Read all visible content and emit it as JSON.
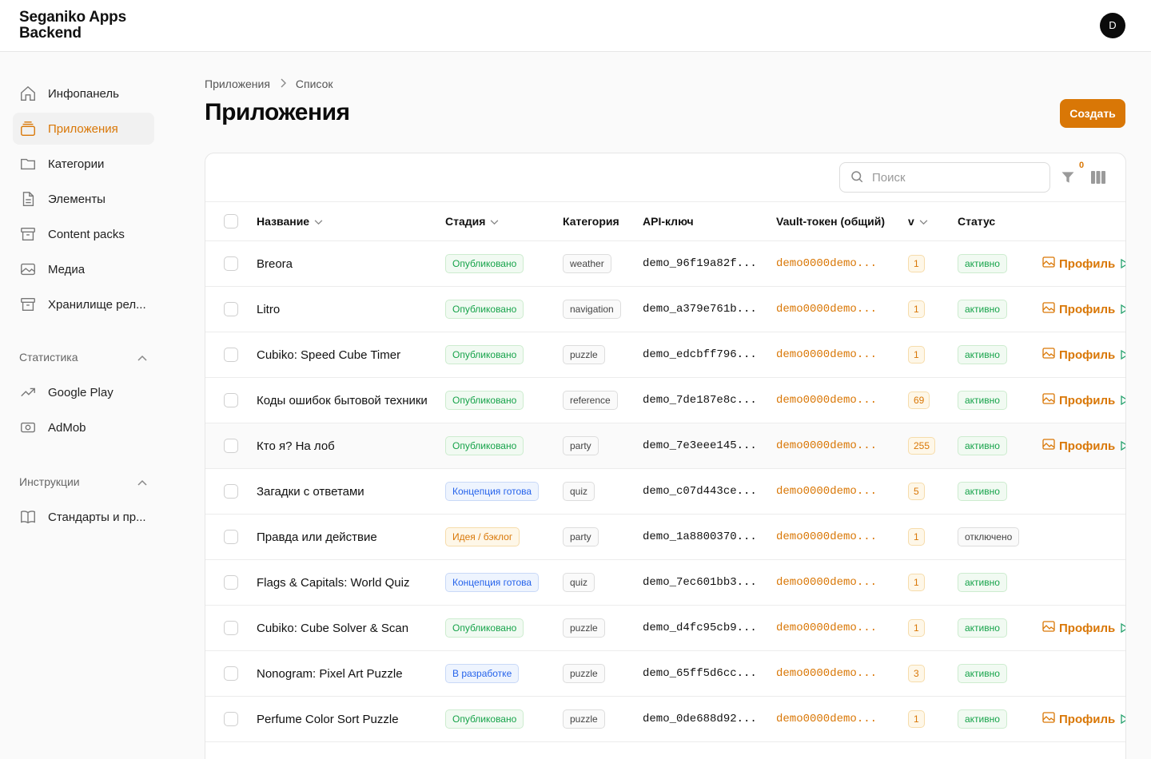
{
  "brand": {
    "line1": "Seganiko Apps",
    "line2": "Backend"
  },
  "user": {
    "avatar_initial": "D"
  },
  "sidebar": {
    "items": [
      {
        "label": "Инфопанель",
        "icon": "home-icon"
      },
      {
        "label": "Приложения",
        "icon": "layers-icon",
        "active": true
      },
      {
        "label": "Категории",
        "icon": "folder-icon"
      },
      {
        "label": "Элементы",
        "icon": "file-icon"
      },
      {
        "label": "Content packs",
        "icon": "archive-icon"
      },
      {
        "label": "Медиа",
        "icon": "image-icon"
      },
      {
        "label": "Хранилище рел...",
        "icon": "archive-icon"
      }
    ],
    "sections": [
      {
        "title": "Статистика",
        "items": [
          {
            "label": "Google Play",
            "icon": "trending-up-icon"
          },
          {
            "label": "AdMob",
            "icon": "money-icon"
          }
        ]
      },
      {
        "title": "Инструкции",
        "items": [
          {
            "label": "Стандарты и пр...",
            "icon": "book-icon"
          }
        ]
      }
    ]
  },
  "breadcrumb": {
    "root": "Приложения",
    "current": "Список"
  },
  "page": {
    "title": "Приложения",
    "create_label": "Создать"
  },
  "toolbar": {
    "search_placeholder": "Поиск",
    "filter_count": "0"
  },
  "colors": {
    "accent": "#d97706",
    "published": "#16a34a",
    "concept": "#2563eb"
  },
  "table": {
    "headers": {
      "name": "Название",
      "stage": "Стадия",
      "category": "Категория",
      "api": "API-ключ",
      "vault": "Vault-токен (общий)",
      "version": "v",
      "status": "Статус"
    },
    "profile_label": "Профиль",
    "rows": [
      {
        "name": "Breora",
        "stage": "Опубликовано",
        "stage_kind": "green",
        "category": "weather",
        "api": "demo_96f19a82f...",
        "vault": "demo0000demo...",
        "version": "1",
        "status": "активно",
        "profile": true
      },
      {
        "name": "Litro",
        "stage": "Опубликовано",
        "stage_kind": "green",
        "category": "navigation",
        "api": "demo_a379e761b...",
        "vault": "demo0000demo...",
        "version": "1",
        "status": "активно",
        "profile": true
      },
      {
        "name": "Cubiko: Speed Cube Timer",
        "stage": "Опубликовано",
        "stage_kind": "green",
        "category": "puzzle",
        "api": "demo_edcbff796...",
        "vault": "demo0000demo...",
        "version": "1",
        "status": "активно",
        "profile": true
      },
      {
        "name": "Коды ошибок бытовой техники",
        "stage": "Опубликовано",
        "stage_kind": "green",
        "category": "reference",
        "api": "demo_7de187e8c...",
        "vault": "demo0000demo...",
        "version": "69",
        "status": "активно",
        "profile": true
      },
      {
        "name": "Кто я? На лоб",
        "stage": "Опубликовано",
        "stage_kind": "green",
        "category": "party",
        "api": "demo_7e3eee145...",
        "vault": "demo0000demo...",
        "version": "255",
        "status": "активно",
        "profile": true,
        "hover": true
      },
      {
        "name": "Загадки с ответами",
        "stage": "Концепция готова",
        "stage_kind": "blue",
        "category": "quiz",
        "api": "demo_c07d443ce...",
        "vault": "demo0000demo...",
        "version": "5",
        "status": "активно",
        "profile": false
      },
      {
        "name": "Правда или действие",
        "stage": "Идея / бэклог",
        "stage_kind": "orange",
        "category": "party",
        "api": "demo_1a8800370...",
        "vault": "demo0000demo...",
        "version": "1",
        "status": "отключено",
        "profile": false
      },
      {
        "name": "Flags & Capitals: World Quiz",
        "stage": "Концепция готова",
        "stage_kind": "blue",
        "category": "quiz",
        "api": "demo_7ec601bb3...",
        "vault": "demo0000demo...",
        "version": "1",
        "status": "активно",
        "profile": false
      },
      {
        "name": "Cubiko: Cube Solver & Scan",
        "stage": "Опубликовано",
        "stage_kind": "green",
        "category": "puzzle",
        "api": "demo_d4fc95cb9...",
        "vault": "demo0000demo...",
        "version": "1",
        "status": "активно",
        "profile": true
      },
      {
        "name": "Nonogram: Pixel Art Puzzle",
        "stage": "В разработке",
        "stage_kind": "blue",
        "category": "puzzle",
        "api": "demo_65ff5d6cc...",
        "vault": "demo0000demo...",
        "version": "3",
        "status": "активно",
        "profile": false
      },
      {
        "name": "Perfume Color Sort Puzzle",
        "stage": "Опубликовано",
        "stage_kind": "green",
        "category": "puzzle",
        "api": "demo_0de688d92...",
        "vault": "demo0000demo...",
        "version": "1",
        "status": "активно",
        "profile": true
      }
    ]
  }
}
